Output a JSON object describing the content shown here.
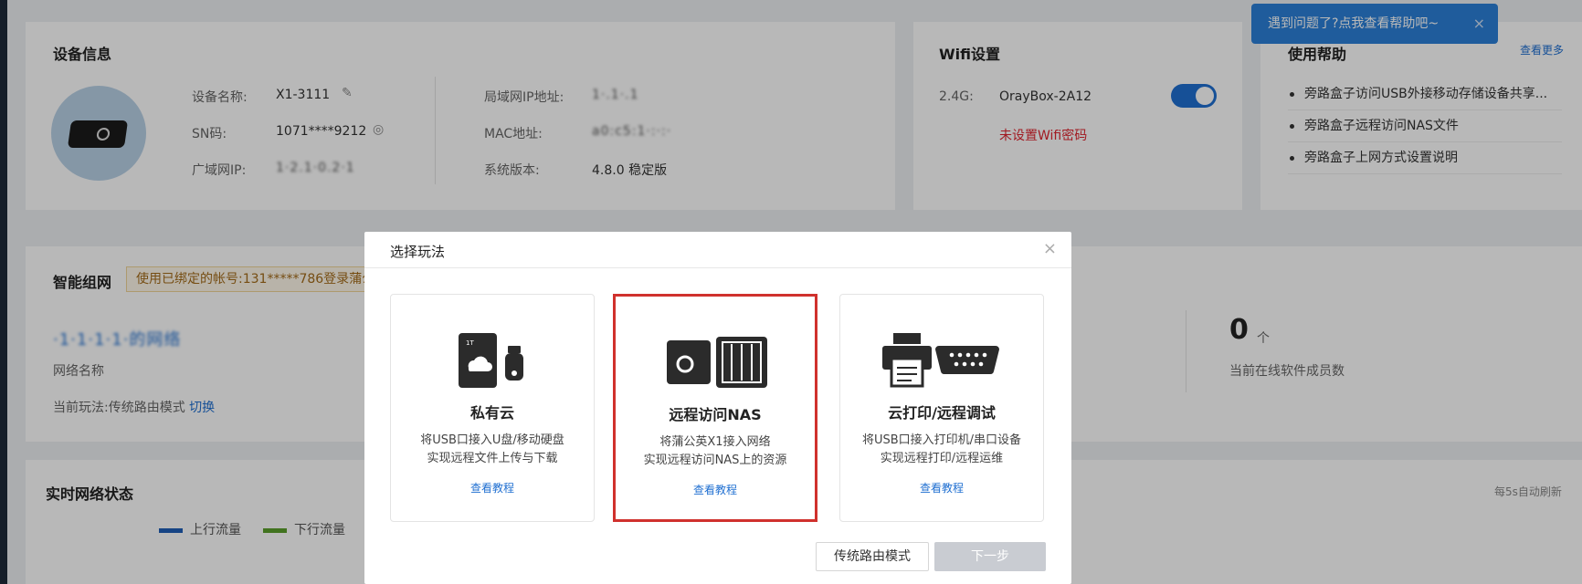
{
  "device": {
    "title": "设备信息",
    "name_label": "设备名称:",
    "name_value": "X1-3111",
    "sn_label": "SN码:",
    "sn_value": "1071****9212",
    "wan_ip_label": "广域网IP:",
    "wan_ip_value": "1·2.1·0.2·1",
    "lan_ip_label": "局域网IP地址:",
    "lan_ip_value": "1·.1·.1",
    "mac_label": "MAC地址:",
    "mac_value": "a0:c5:1·:·:·",
    "version_label": "系统版本:",
    "version_value": "4.8.0 稳定版"
  },
  "wifi": {
    "title": "Wifi设置",
    "band": "2.4G:",
    "ssid": "OrayBox-2A12",
    "enabled": true,
    "warning": "未设置Wifi密码"
  },
  "help": {
    "title": "使用帮助",
    "more": "查看更多",
    "items": [
      "旁路盒子访问USB外接移动存储设备共享...",
      "旁路盒子远程访问NAS文件",
      "旁路盒子上网方式设置说明"
    ],
    "tooltip": "遇到问题了?点我查看帮助吧~",
    "tooltip_close": "×"
  },
  "network": {
    "title": "智能组网",
    "notice": "使用已绑定的帐号:131*****786登录蒲公",
    "net_name": "·1·1·1·1·的网络",
    "net_name_label": "网络名称",
    "mode_label": "当前玩法:传统路由模式",
    "switch_link": "切换",
    "online_count": "0",
    "online_unit": "个",
    "online_label": "当前在线软件成员数"
  },
  "status": {
    "title": "实时网络状态",
    "refresh": "每5s自动刷新",
    "legend_up": "上行流量",
    "legend_down": "下行流量",
    "colors": {
      "up": "#1f5fb8",
      "down": "#5aa02c"
    }
  },
  "modal": {
    "title": "选择玩法",
    "close": "×",
    "options": [
      {
        "icon": "private-cloud-icon",
        "title": "私有云",
        "desc1": "将USB口接入U盘/移动硬盘",
        "desc2": "实现远程文件上传与下载",
        "link": "查看教程",
        "selected": false
      },
      {
        "icon": "remote-nas-icon",
        "title": "远程访问NAS",
        "desc1": "将蒲公英X1接入网络",
        "desc2": "实现远程访问NAS上的资源",
        "link": "查看教程",
        "selected": true
      },
      {
        "icon": "remote-print-icon",
        "title": "云打印/远程调试",
        "desc1": "将USB口接入打印机/串口设备",
        "desc2": "实现远程打印/远程运维",
        "link": "查看教程",
        "selected": false
      }
    ],
    "btn_secondary": "传统路由模式",
    "btn_primary": "下一步"
  }
}
